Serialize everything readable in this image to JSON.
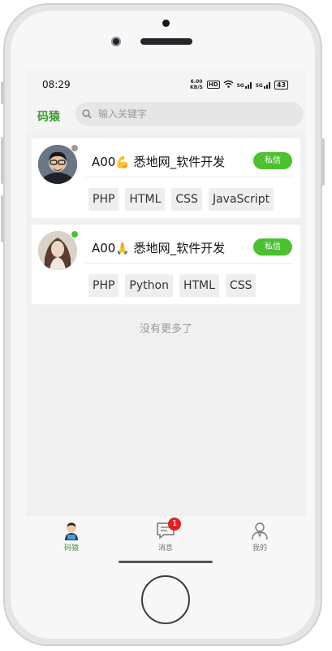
{
  "status": {
    "time": "08:29",
    "speed": "6.00 KB/S",
    "hd": "HD",
    "net1": "5G",
    "net2": "5G",
    "battery": "43"
  },
  "header": {
    "logo": "码猿",
    "search_placeholder": "输入关键字"
  },
  "developers": [
    {
      "name": "A00",
      "emoji": "💪",
      "title": "悉地网_软件开发",
      "online": false,
      "button": "私信",
      "tags": [
        "PHP",
        "HTML",
        "CSS",
        "JavaScript"
      ]
    },
    {
      "name": "A00",
      "emoji": "🙏",
      "title": "悉地网_软件开发",
      "online": true,
      "button": "私信",
      "tags": [
        "PHP",
        "Python",
        "HTML",
        "CSS"
      ]
    }
  ],
  "list_end": "没有更多了",
  "tabs": [
    {
      "label": "码猿",
      "icon": "developer-avatar-icon",
      "active": true
    },
    {
      "label": "消息",
      "icon": "message-icon",
      "badge": "1"
    },
    {
      "label": "我的",
      "icon": "user-profile-icon"
    }
  ],
  "colors": {
    "brand_green": "#3a9a2f",
    "button_green": "#4cc12f",
    "online_dot": "#4cc12f",
    "offline_dot": "#9a9a9a",
    "badge_red": "#e02020"
  }
}
